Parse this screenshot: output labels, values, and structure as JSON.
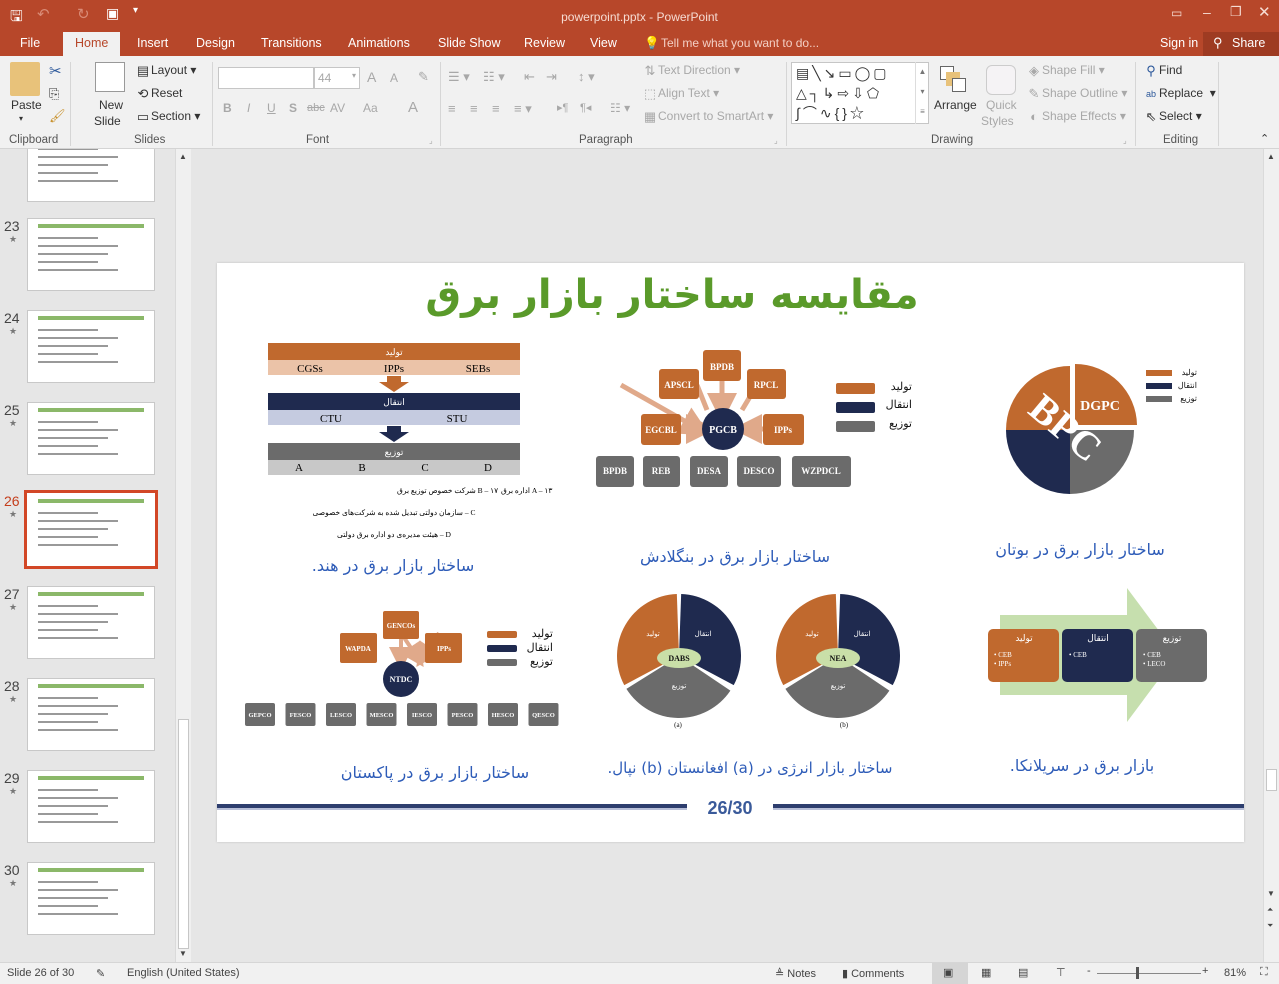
{
  "window": {
    "title": "powerpoint.pptx - PowerPoint",
    "qat": [
      "save-icon",
      "undo-icon",
      "redo-icon",
      "start-from-beginning-icon",
      "customize-icon"
    ]
  },
  "tabs": [
    "File",
    "Home",
    "Insert",
    "Design",
    "Transitions",
    "Animations",
    "Slide Show",
    "Review",
    "View"
  ],
  "active_tab": "Home",
  "tell_me": "Tell me what you want to do...",
  "sign_in": "Sign in",
  "share": "Share",
  "ribbon": {
    "clipboard": {
      "paste": "Paste",
      "label": "Clipboard"
    },
    "slides": {
      "new_slide_1": "New",
      "new_slide_2": "Slide",
      "layout": "Layout",
      "reset": "Reset",
      "section": "Section",
      "label": "Slides"
    },
    "font": {
      "font_name": "",
      "font_size": "44",
      "bold": "B",
      "italic": "I",
      "underline": "U",
      "shadow": "S",
      "strike": "abc",
      "spacing": "AV",
      "case": "Aa",
      "color": "A",
      "grow": "A",
      "shrink": "A",
      "label": "Font"
    },
    "paragraph": {
      "text_direction": "Text Direction",
      "align_text": "Align Text",
      "convert": "Convert to SmartArt",
      "label": "Paragraph"
    },
    "drawing": {
      "arrange": "Arrange",
      "quick_styles_1": "Quick",
      "quick_styles_2": "Styles",
      "shape_fill": "Shape Fill",
      "shape_outline": "Shape Outline",
      "shape_effects": "Shape Effects",
      "label": "Drawing"
    },
    "editing": {
      "find": "Find",
      "replace": "Replace",
      "select": "Select",
      "label": "Editing"
    }
  },
  "thumbnails": [
    {
      "num": ""
    },
    {
      "num": "23"
    },
    {
      "num": "24"
    },
    {
      "num": "25"
    },
    {
      "num": "26",
      "selected": true
    },
    {
      "num": "27"
    },
    {
      "num": "28"
    },
    {
      "num": "29"
    },
    {
      "num": "30"
    }
  ],
  "slide": {
    "title": "مقایسه ساختار بازار برق",
    "legend": {
      "gen": "تولید",
      "trans": "انتقال",
      "dist": "توزیع"
    },
    "colors": {
      "generation": "#C0692E",
      "transmission": "#1F2A4F",
      "distribution": "#6B6B6B",
      "title": "#5A9A2A",
      "caption": "#2E5CB8"
    },
    "india": {
      "caption": "ساختار بازار برق در هند.",
      "gen_entities": [
        "CGSs",
        "IPPs",
        "SEBs"
      ],
      "trans_entities": [
        "CTU",
        "STU"
      ],
      "dist_entities": [
        "A",
        "B",
        "C",
        "D"
      ],
      "notes": [
        "A – ۱۳ اداره برق",
        "B – ۱۷ شرکت خصوص توزیع برق",
        "C – سازمان دولتی تبدیل شده به شرکت‌های خصوصی",
        "D – هیئت مدیره‌ی دو اداره برق دولتی"
      ]
    },
    "bangladesh": {
      "caption": "ساختار بازار برق در بنگلادش",
      "center": "PGCB",
      "gen": [
        "BPDB",
        "APSCL",
        "RPCL",
        "EGCBL",
        "IPPs"
      ],
      "dist": [
        "BPDB",
        "REB",
        "DESA",
        "DESCO",
        "WZPDCL"
      ]
    },
    "bhutan": {
      "caption": "ساختار بازار برق در بوتان",
      "gen": "DGPC",
      "main": "BPC"
    },
    "pakistan": {
      "caption": "ساختار بازار برق در پاکستان",
      "center": "NTDC",
      "gen": [
        "GENCOs",
        "WAPDA",
        "IPPs"
      ],
      "dist": [
        "GEPCO",
        "FESCO",
        "LESCO",
        "MESCO",
        "IESCO",
        "PESCO",
        "HESCO",
        "QESCO"
      ]
    },
    "afg_nepal": {
      "caption": "ساختار بازار انرژی در (a) افغانستان (b) نپال.",
      "a_center": "DABS",
      "b_center": "NEA",
      "a_label": "(a)",
      "b_label": "(b)"
    },
    "srilanka": {
      "caption": "بازار برق در سریلانکا.",
      "gen_items": [
        "CEB",
        "IPPs"
      ],
      "trans_items": [
        "CEB"
      ],
      "dist_items": [
        "CEB",
        "LECO"
      ]
    },
    "page": "26/30"
  },
  "status": {
    "slide": "Slide 26 of 30",
    "language": "English (United States)",
    "notes": "Notes",
    "comments": "Comments",
    "zoom": "81%",
    "zoom_level_percent": 81
  }
}
